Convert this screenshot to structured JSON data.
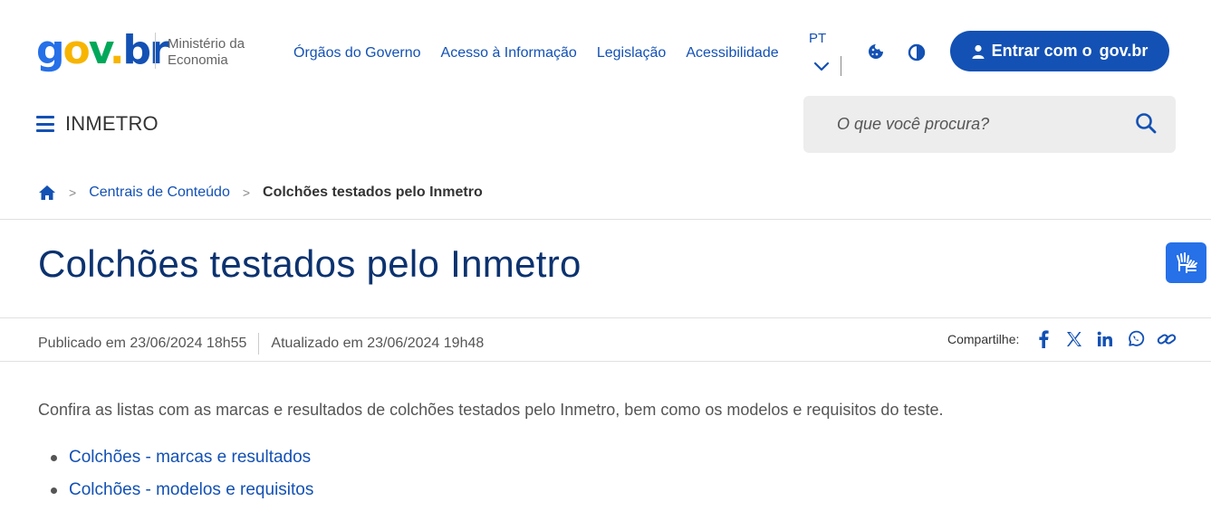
{
  "brand": {
    "logo_parts": [
      "g",
      "o",
      "v",
      ".",
      "br"
    ],
    "ministry": "Ministério da Economia"
  },
  "nav": {
    "items": [
      {
        "label": "Órgãos do Governo"
      },
      {
        "label": "Acesso à Informação"
      },
      {
        "label": "Legislação"
      },
      {
        "label": "Acessibilidade"
      }
    ],
    "language": "PT",
    "login_prefix": "Entrar com o",
    "login_brand": "gov.br"
  },
  "site": {
    "name": "INMETRO"
  },
  "search": {
    "placeholder": "O que você procura?"
  },
  "breadcrumb": {
    "items": [
      {
        "label": "Centrais de Conteúdo"
      },
      {
        "label": "Colchões testados pelo Inmetro"
      }
    ]
  },
  "page": {
    "title": "Colchões testados pelo Inmetro",
    "published": "Publicado em 23/06/2024 18h55",
    "updated": "Atualizado em 23/06/2024 19h48",
    "share_label": "Compartilhe:",
    "intro": "Confira as listas com as marcas e resultados de colchões testados pelo Inmetro, bem como os modelos e requisitos do teste.",
    "links": [
      {
        "label": "Colchões - marcas e resultados"
      },
      {
        "label": "Colchões - modelos e requisitos"
      }
    ]
  },
  "icons": {
    "home": "home-icon",
    "cookie": "cookie-icon",
    "contrast": "contrast-icon",
    "user": "user-icon",
    "search": "search-icon",
    "chevron": "chevron-down-icon",
    "facebook": "facebook-icon",
    "x": "x-icon",
    "linkedin": "linkedin-icon",
    "whatsapp": "whatsapp-icon",
    "link": "link-icon",
    "vlibras": "vlibras-hands-icon"
  },
  "colors": {
    "primary": "#1351b4",
    "title": "#0c326f",
    "accent_blue": "#2670e8",
    "search_bg": "#ededed"
  }
}
